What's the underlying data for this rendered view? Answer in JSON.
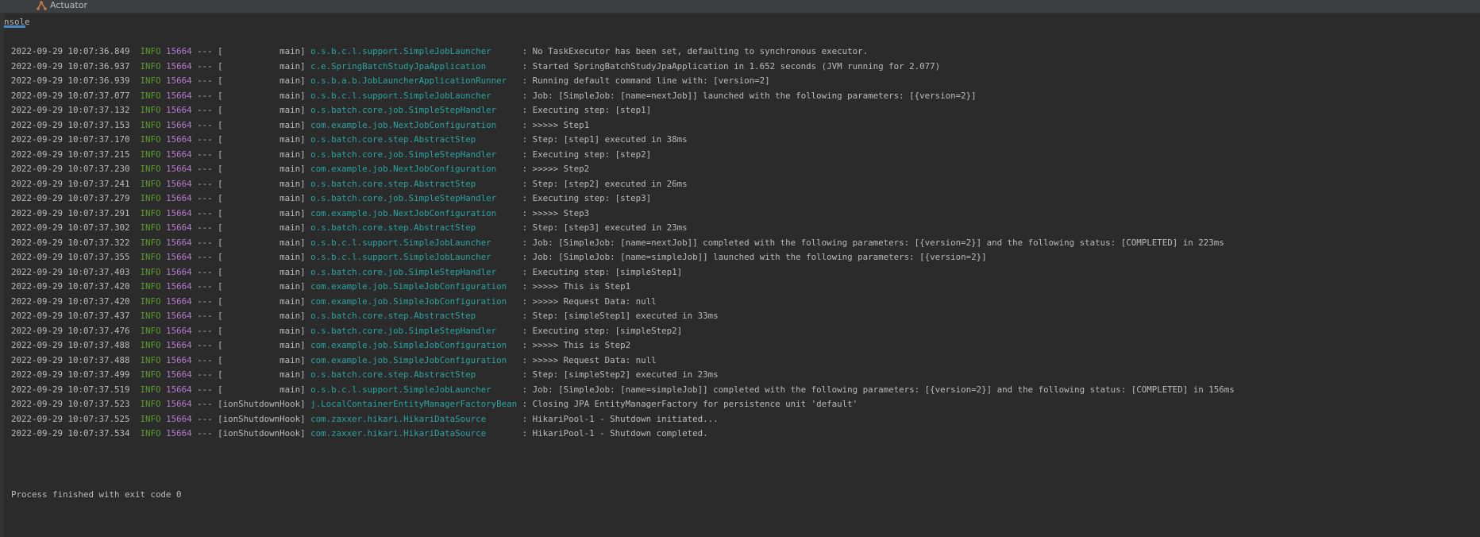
{
  "tabs": [
    {
      "label": "Console",
      "active": true,
      "icon": "none"
    },
    {
      "label": "Actuator",
      "active": false,
      "icon": "actuator-icon"
    }
  ],
  "colors": {
    "level": "#5e9c2f",
    "pid": "#b77bd0",
    "logger": "#2aa5a0",
    "text": "#bbbbbb",
    "background": "#2b2b2b"
  },
  "log": [
    {
      "time": "2022-09-29 10:07:36.849",
      "level": "INFO",
      "pid": "15664",
      "thread": "main",
      "logger": "o.s.b.c.l.support.SimpleJobLauncher",
      "message": "No TaskExecutor has been set, defaulting to synchronous executor."
    },
    {
      "time": "2022-09-29 10:07:36.937",
      "level": "INFO",
      "pid": "15664",
      "thread": "main",
      "logger": "c.e.SpringBatchStudyJpaApplication",
      "message": "Started SpringBatchStudyJpaApplication in 1.652 seconds (JVM running for 2.077)"
    },
    {
      "time": "2022-09-29 10:07:36.939",
      "level": "INFO",
      "pid": "15664",
      "thread": "main",
      "logger": "o.s.b.a.b.JobLauncherApplicationRunner",
      "message": "Running default command line with: [version=2]"
    },
    {
      "time": "2022-09-29 10:07:37.077",
      "level": "INFO",
      "pid": "15664",
      "thread": "main",
      "logger": "o.s.b.c.l.support.SimpleJobLauncher",
      "message": "Job: [SimpleJob: [name=nextJob]] launched with the following parameters: [{version=2}]"
    },
    {
      "time": "2022-09-29 10:07:37.132",
      "level": "INFO",
      "pid": "15664",
      "thread": "main",
      "logger": "o.s.batch.core.job.SimpleStepHandler",
      "message": "Executing step: [step1]"
    },
    {
      "time": "2022-09-29 10:07:37.153",
      "level": "INFO",
      "pid": "15664",
      "thread": "main",
      "logger": "com.example.job.NextJobConfiguration",
      "message": ">>>>> Step1"
    },
    {
      "time": "2022-09-29 10:07:37.170",
      "level": "INFO",
      "pid": "15664",
      "thread": "main",
      "logger": "o.s.batch.core.step.AbstractStep",
      "message": "Step: [step1] executed in 38ms"
    },
    {
      "time": "2022-09-29 10:07:37.215",
      "level": "INFO",
      "pid": "15664",
      "thread": "main",
      "logger": "o.s.batch.core.job.SimpleStepHandler",
      "message": "Executing step: [step2]"
    },
    {
      "time": "2022-09-29 10:07:37.230",
      "level": "INFO",
      "pid": "15664",
      "thread": "main",
      "logger": "com.example.job.NextJobConfiguration",
      "message": ">>>>> Step2"
    },
    {
      "time": "2022-09-29 10:07:37.241",
      "level": "INFO",
      "pid": "15664",
      "thread": "main",
      "logger": "o.s.batch.core.step.AbstractStep",
      "message": "Step: [step2] executed in 26ms"
    },
    {
      "time": "2022-09-29 10:07:37.279",
      "level": "INFO",
      "pid": "15664",
      "thread": "main",
      "logger": "o.s.batch.core.job.SimpleStepHandler",
      "message": "Executing step: [step3]"
    },
    {
      "time": "2022-09-29 10:07:37.291",
      "level": "INFO",
      "pid": "15664",
      "thread": "main",
      "logger": "com.example.job.NextJobConfiguration",
      "message": ">>>>> Step3"
    },
    {
      "time": "2022-09-29 10:07:37.302",
      "level": "INFO",
      "pid": "15664",
      "thread": "main",
      "logger": "o.s.batch.core.step.AbstractStep",
      "message": "Step: [step3] executed in 23ms"
    },
    {
      "time": "2022-09-29 10:07:37.322",
      "level": "INFO",
      "pid": "15664",
      "thread": "main",
      "logger": "o.s.b.c.l.support.SimpleJobLauncher",
      "message": "Job: [SimpleJob: [name=nextJob]] completed with the following parameters: [{version=2}] and the following status: [COMPLETED] in 223ms"
    },
    {
      "time": "2022-09-29 10:07:37.355",
      "level": "INFO",
      "pid": "15664",
      "thread": "main",
      "logger": "o.s.b.c.l.support.SimpleJobLauncher",
      "message": "Job: [SimpleJob: [name=simpleJob]] launched with the following parameters: [{version=2}]"
    },
    {
      "time": "2022-09-29 10:07:37.403",
      "level": "INFO",
      "pid": "15664",
      "thread": "main",
      "logger": "o.s.batch.core.job.SimpleStepHandler",
      "message": "Executing step: [simpleStep1]"
    },
    {
      "time": "2022-09-29 10:07:37.420",
      "level": "INFO",
      "pid": "15664",
      "thread": "main",
      "logger": "com.example.job.SimpleJobConfiguration",
      "message": ">>>>> This is Step1"
    },
    {
      "time": "2022-09-29 10:07:37.420",
      "level": "INFO",
      "pid": "15664",
      "thread": "main",
      "logger": "com.example.job.SimpleJobConfiguration",
      "message": ">>>>> Request Data: null"
    },
    {
      "time": "2022-09-29 10:07:37.437",
      "level": "INFO",
      "pid": "15664",
      "thread": "main",
      "logger": "o.s.batch.core.step.AbstractStep",
      "message": "Step: [simpleStep1] executed in 33ms"
    },
    {
      "time": "2022-09-29 10:07:37.476",
      "level": "INFO",
      "pid": "15664",
      "thread": "main",
      "logger": "o.s.batch.core.job.SimpleStepHandler",
      "message": "Executing step: [simpleStep2]"
    },
    {
      "time": "2022-09-29 10:07:37.488",
      "level": "INFO",
      "pid": "15664",
      "thread": "main",
      "logger": "com.example.job.SimpleJobConfiguration",
      "message": ">>>>> This is Step2"
    },
    {
      "time": "2022-09-29 10:07:37.488",
      "level": "INFO",
      "pid": "15664",
      "thread": "main",
      "logger": "com.example.job.SimpleJobConfiguration",
      "message": ">>>>> Request Data: null"
    },
    {
      "time": "2022-09-29 10:07:37.499",
      "level": "INFO",
      "pid": "15664",
      "thread": "main",
      "logger": "o.s.batch.core.step.AbstractStep",
      "message": "Step: [simpleStep2] executed in 23ms"
    },
    {
      "time": "2022-09-29 10:07:37.519",
      "level": "INFO",
      "pid": "15664",
      "thread": "main",
      "logger": "o.s.b.c.l.support.SimpleJobLauncher",
      "message": "Job: [SimpleJob: [name=simpleJob]] completed with the following parameters: [{version=2}] and the following status: [COMPLETED] in 156ms"
    },
    {
      "time": "2022-09-29 10:07:37.523",
      "level": "INFO",
      "pid": "15664",
      "thread": "ionShutdownHook",
      "logger": "j.LocalContainerEntityManagerFactoryBean",
      "message": "Closing JPA EntityManagerFactory for persistence unit 'default'"
    },
    {
      "time": "2022-09-29 10:07:37.525",
      "level": "INFO",
      "pid": "15664",
      "thread": "ionShutdownHook",
      "logger": "com.zaxxer.hikari.HikariDataSource",
      "message": "HikariPool-1 - Shutdown initiated..."
    },
    {
      "time": "2022-09-29 10:07:37.534",
      "level": "INFO",
      "pid": "15664",
      "thread": "ionShutdownHook",
      "logger": "com.zaxxer.hikari.HikariDataSource",
      "message": "HikariPool-1 - Shutdown completed."
    }
  ],
  "exit_message": "Process finished with exit code 0"
}
